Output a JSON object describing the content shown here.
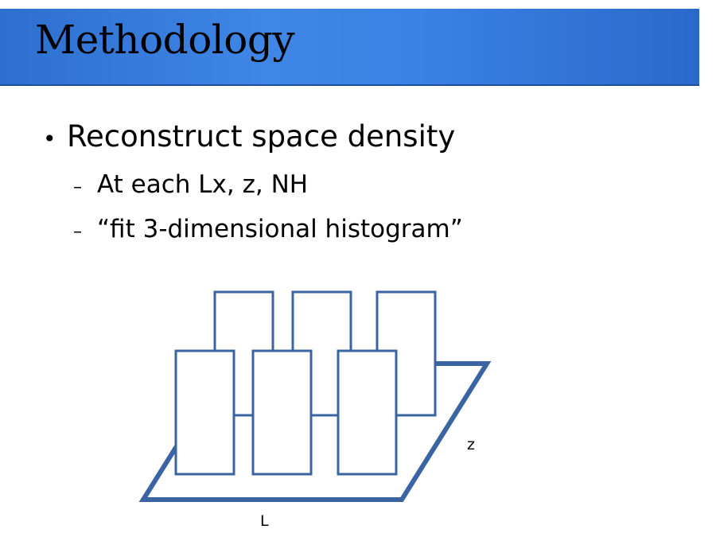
{
  "slide": {
    "title": "Methodology",
    "bullets": [
      {
        "marker": "•",
        "text": "Reconstruct space density"
      },
      {
        "marker": "–",
        "text": "At each Lx, z, NH"
      },
      {
        "marker": "–",
        "text": "“fit 3-dimensional histogram”"
      }
    ]
  },
  "diagram": {
    "axis_z": "z",
    "axis_l": "L",
    "stroke_color": "#3a64a2"
  }
}
